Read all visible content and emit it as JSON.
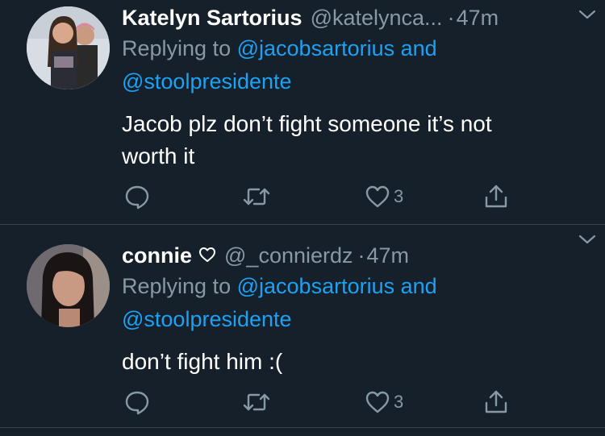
{
  "tweets": [
    {
      "name": "Katelyn Sartorius",
      "handle": "@katelynca...",
      "separator": "·",
      "time": "47m",
      "replying_prefix": "Replying to",
      "replying_mentions": "@jacobsartorius and",
      "replying_mentions_line2": "@stoolpresidente",
      "text": "Jacob plz don’t fight someone it’s not worth it",
      "like_count": "3",
      "has_heart": false
    },
    {
      "name": "connie",
      "handle": "@_connierdz",
      "separator": "·",
      "time": "47m",
      "replying_prefix": "Replying to",
      "replying_mentions": "@jacobsartorius and",
      "replying_mentions_line2": "@stoolpresidente",
      "text": "don’t fight him :(",
      "like_count": "3",
      "has_heart": true
    }
  ],
  "colors": {
    "background": "#15202b",
    "secondary_text": "#8899a6",
    "link": "#1da1f2",
    "divider": "#38444d"
  },
  "icons": [
    "reply-icon",
    "retweet-icon",
    "like-icon",
    "share-icon",
    "chevron-down-icon",
    "heart-icon"
  ]
}
